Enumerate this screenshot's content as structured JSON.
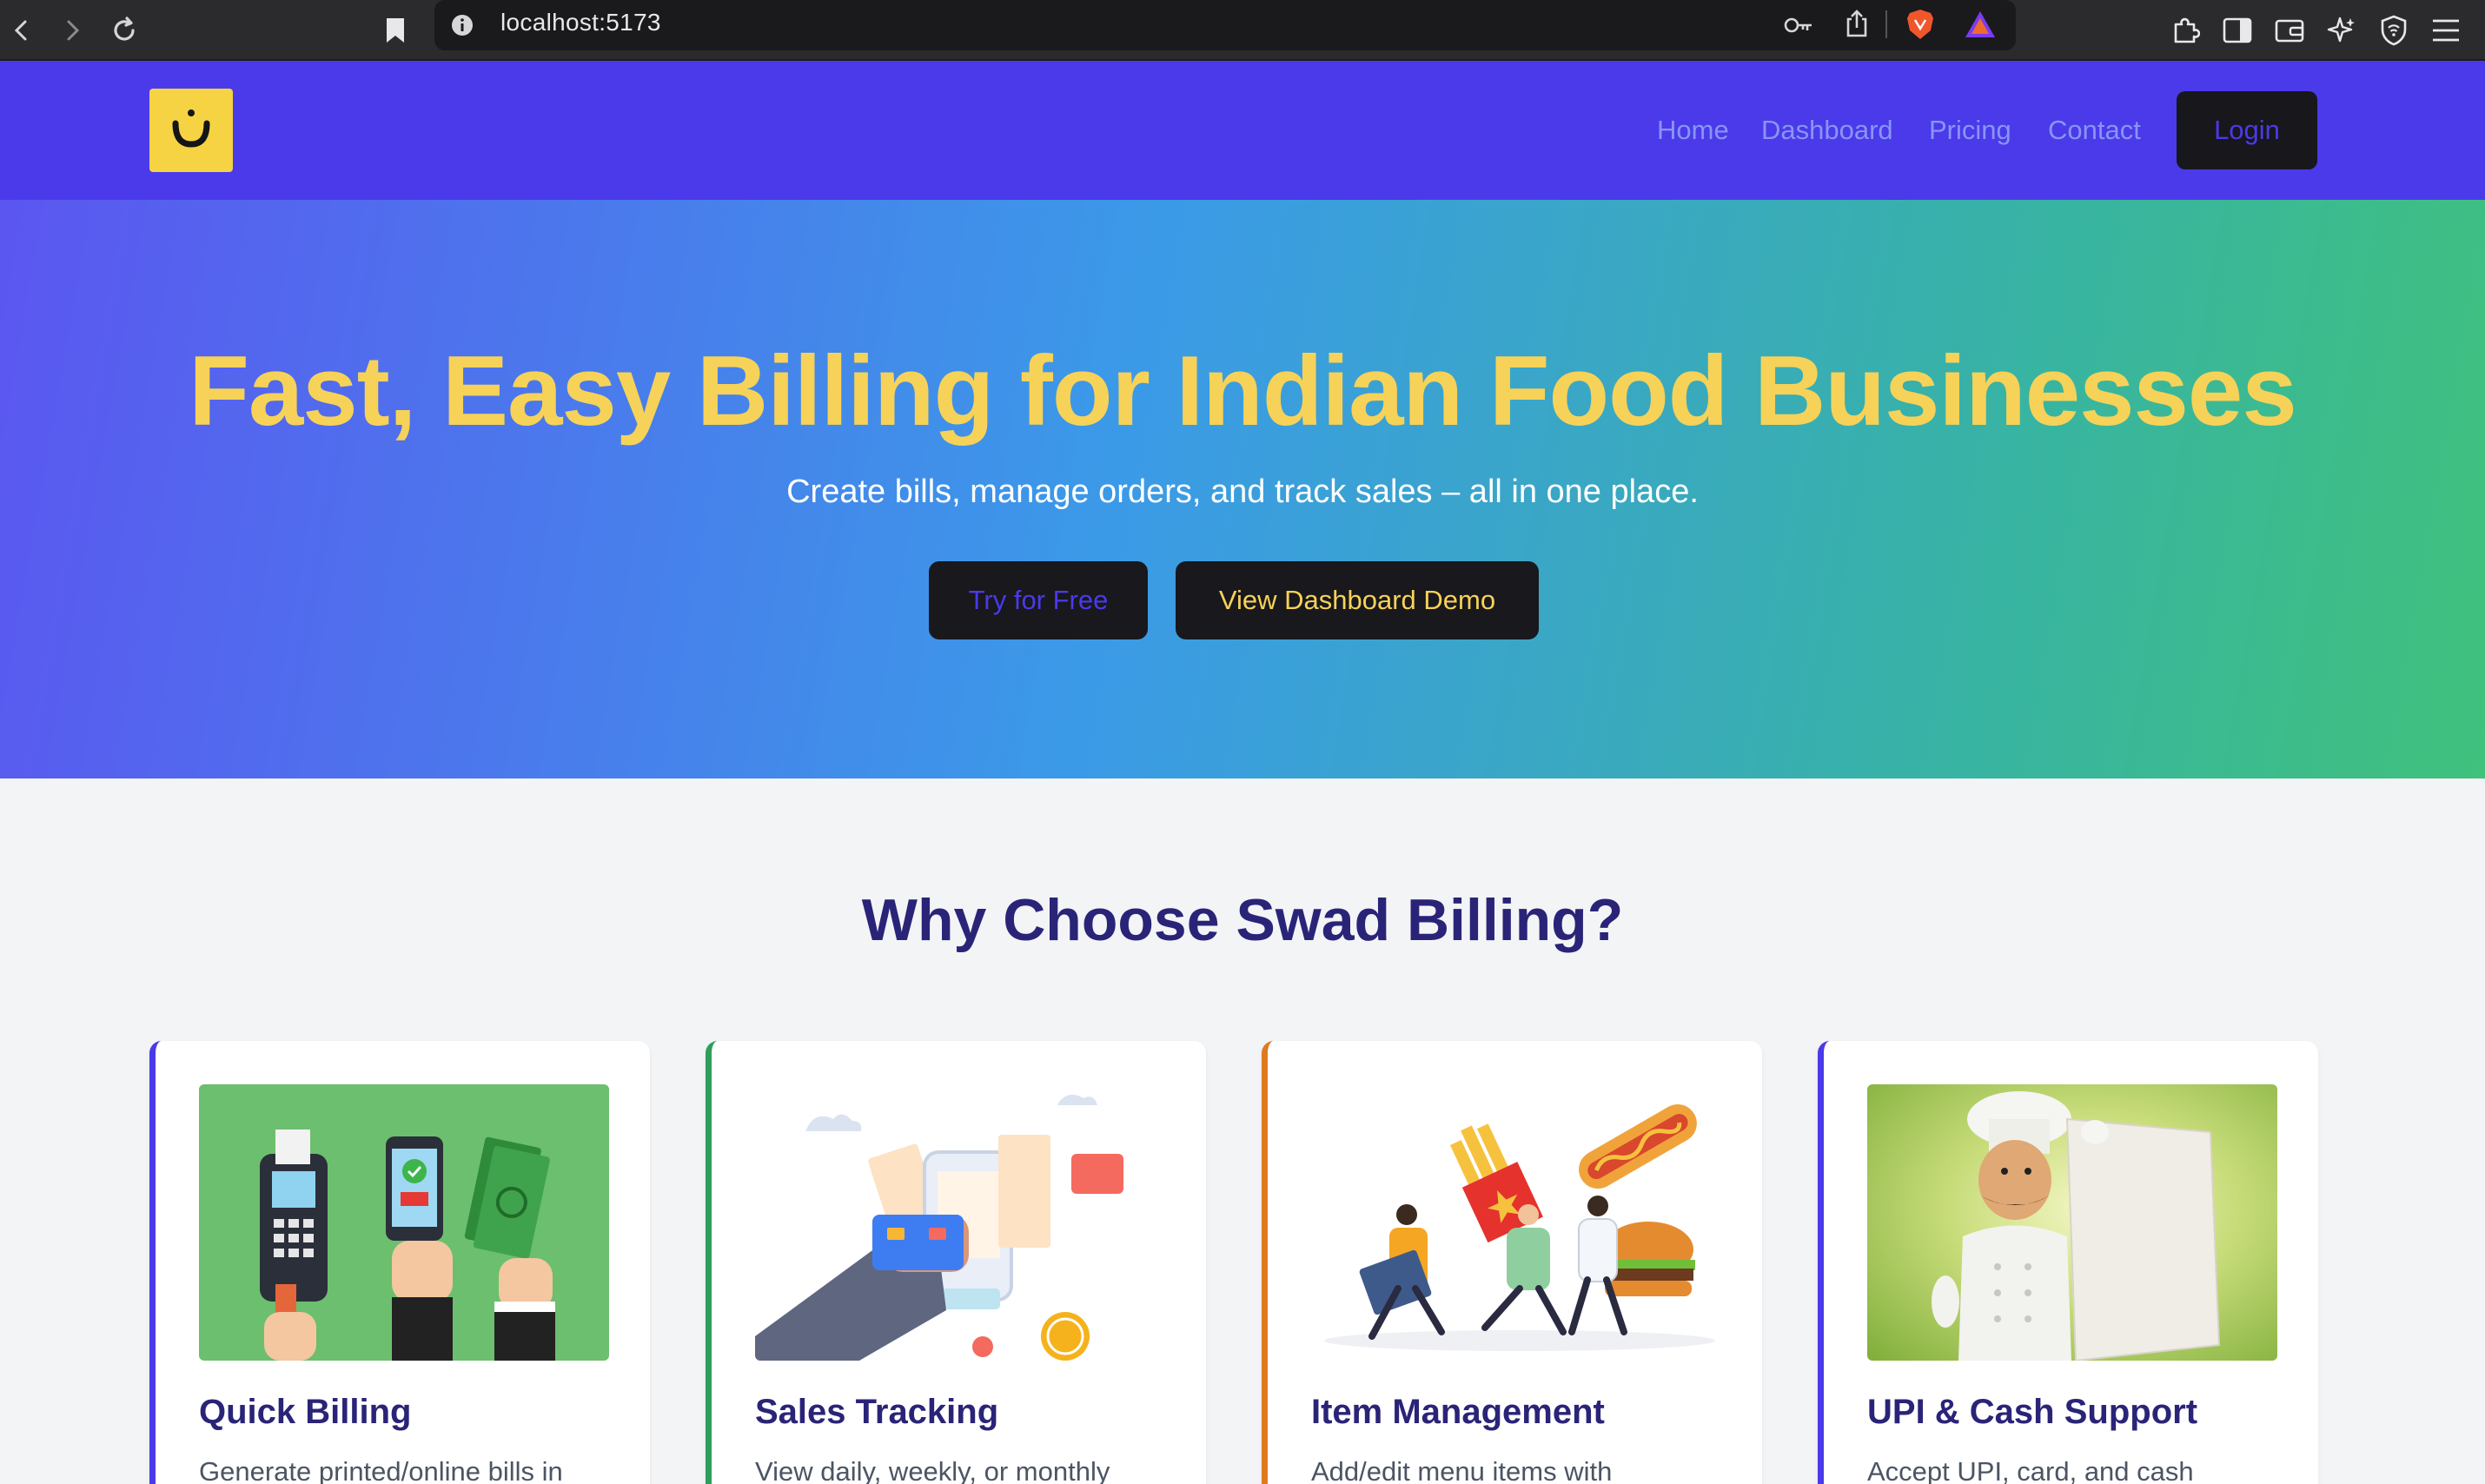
{
  "browser": {
    "url": "localhost:5173"
  },
  "nav": {
    "links": [
      "Home",
      "Dashboard",
      "Pricing",
      "Contact"
    ],
    "login_label": "Login"
  },
  "hero": {
    "title": "Fast, Easy Billing for Indian Food Businesses",
    "subtitle": "Create bills, manage orders, and track sales – all in one place.",
    "try_label": "Try for Free",
    "demo_label": "View Dashboard Demo"
  },
  "features": {
    "title": "Why Choose Swad Billing?",
    "cards": [
      {
        "title": "Quick Billing",
        "desc": "Generate printed/online bills in",
        "accent": "#4a3aea"
      },
      {
        "title": "Sales Tracking",
        "desc": "View daily, weekly, or monthly",
        "accent": "#2e9e5b"
      },
      {
        "title": "Item Management",
        "desc": "Add/edit menu items with",
        "accent": "#e07a1f"
      },
      {
        "title": "UPI & Cash Support",
        "desc": "Accept UPI, card, and cash",
        "accent": "#4a3aea"
      }
    ]
  },
  "colors": {
    "nav_bg": "#4a3aea",
    "accent_yellow": "#f6d258",
    "heading_navy": "#2a2478"
  }
}
